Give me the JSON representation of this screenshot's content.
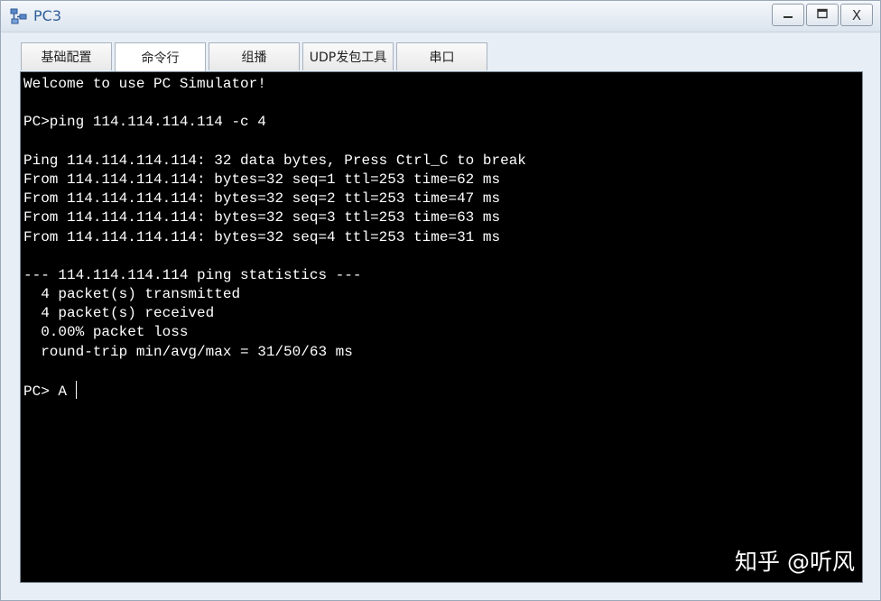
{
  "window": {
    "title": "PC3",
    "controls": {
      "minimize_icon": "minimize-icon",
      "maximize_icon": "maximize-icon",
      "close_label": "X"
    }
  },
  "tabs": [
    {
      "label": "基础配置",
      "active": false
    },
    {
      "label": "命令行",
      "active": true
    },
    {
      "label": "组播",
      "active": false
    },
    {
      "label": "UDP发包工具",
      "active": false
    },
    {
      "label": "串口",
      "active": false
    }
  ],
  "terminal": {
    "lines": [
      "Welcome to use PC Simulator!",
      "",
      "PC>ping 114.114.114.114 -c 4",
      "",
      "Ping 114.114.114.114: 32 data bytes, Press Ctrl_C to break",
      "From 114.114.114.114: bytes=32 seq=1 ttl=253 time=62 ms",
      "From 114.114.114.114: bytes=32 seq=2 ttl=253 time=47 ms",
      "From 114.114.114.114: bytes=32 seq=3 ttl=253 time=63 ms",
      "From 114.114.114.114: bytes=32 seq=4 ttl=253 time=31 ms",
      "",
      "--- 114.114.114.114 ping statistics ---",
      "  4 packet(s) transmitted",
      "  4 packet(s) received",
      "  0.00% packet loss",
      "  round-trip min/avg/max = 31/50/63 ms",
      ""
    ],
    "prompt": "PC> A ",
    "background": "#000000",
    "foreground": "#ffffff"
  },
  "watermark": "知乎 @听风"
}
